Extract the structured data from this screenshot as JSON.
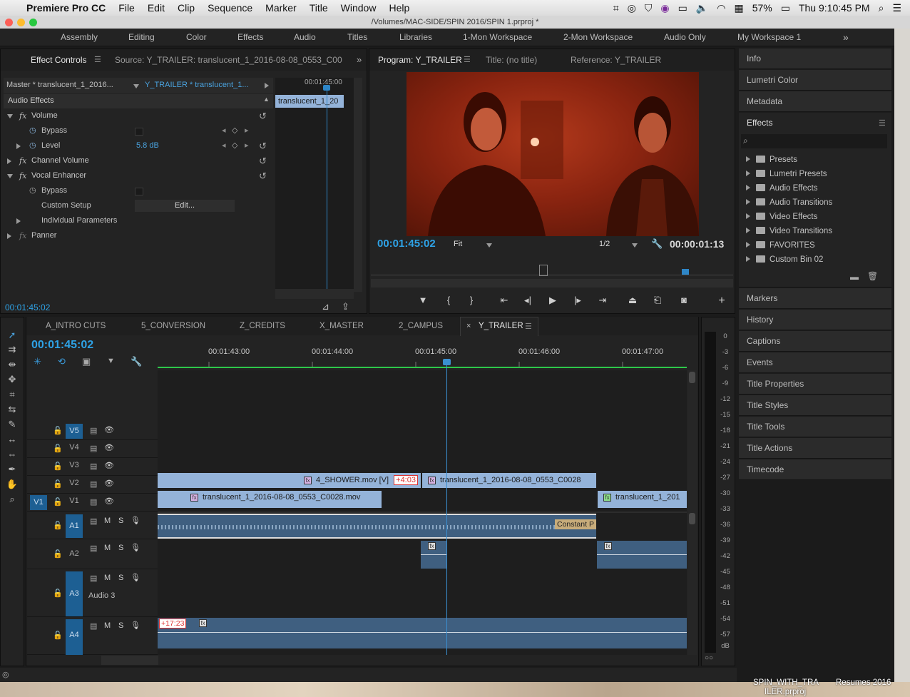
{
  "menubar": {
    "app_name": "Premiere Pro CC",
    "items": [
      "File",
      "Edit",
      "Clip",
      "Sequence",
      "Marker",
      "Title",
      "Window",
      "Help"
    ],
    "battery": "57%",
    "clock": "Thu 9:10:45 PM"
  },
  "window": {
    "title": "/Volumes/MAC-SIDE/SPIN 2016/SPIN 1.prproj *"
  },
  "workspaces": [
    "Assembly",
    "Editing",
    "Color",
    "Effects",
    "Audio",
    "Titles",
    "Libraries",
    "1-Mon Workspace",
    "2-Mon Workspace",
    "Audio Only",
    "My Workspace 1"
  ],
  "effect_controls": {
    "tab_active": "Effect Controls",
    "tab_source": "Source: Y_TRAILER: translucent_1_2016-08-08_0553_C00",
    "master_label": "Master * translucent_1_2016...",
    "sequence_label": "Y_TRAILER * translucent_1...",
    "ruler_time": "00:01:45:00",
    "clip_name": "translucent_1_20",
    "section": "Audio Effects",
    "rows": [
      {
        "name": "Volume",
        "type": "fx"
      },
      {
        "name": "Bypass",
        "type": "param"
      },
      {
        "name": "Level",
        "type": "param",
        "value": "5.8 dB"
      },
      {
        "name": "Channel Volume",
        "type": "fx"
      },
      {
        "name": "Vocal Enhancer",
        "type": "fx"
      },
      {
        "name": "Bypass",
        "type": "param"
      },
      {
        "name": "Custom Setup",
        "type": "param",
        "value": "Edit..."
      },
      {
        "name": "Individual Parameters",
        "type": "param"
      },
      {
        "name": "Panner",
        "type": "fx"
      }
    ],
    "timecode": "00:01:45:02"
  },
  "program": {
    "tab_active": "Program: Y_TRAILER",
    "tab_title": "Title: (no title)",
    "tab_reference": "Reference: Y_TRAILER",
    "timecode": "00:01:45:02",
    "zoom": "Fit",
    "resolution": "1/2",
    "duration": "00:00:01:13"
  },
  "right_panel": {
    "top_items": [
      "Info",
      "Lumetri Color",
      "Metadata"
    ],
    "effects_title": "Effects",
    "effects_items": [
      "Presets",
      "Lumetri Presets",
      "Audio Effects",
      "Audio Transitions",
      "Video Effects",
      "Video Transitions",
      "FAVORITES",
      "Custom Bin 02"
    ],
    "bottom_items": [
      "Markers",
      "History",
      "Captions",
      "Events",
      "Title Properties",
      "Title Styles",
      "Title Tools",
      "Title Actions",
      "Timecode"
    ]
  },
  "timeline": {
    "tabs": [
      "A_INTRO CUTS",
      "5_CONVERSION",
      "Z_CREDITS",
      "X_MASTER",
      "2_CAMPUS",
      "Y_TRAILER"
    ],
    "active_tab": "Y_TRAILER",
    "timecode": "00:01:45:02",
    "ruler": [
      "00:01:43:00",
      "00:01:44:00",
      "00:01:45:00",
      "00:01:46:00",
      "00:01:47:00"
    ],
    "video_tracks": [
      "V5",
      "V4",
      "V3",
      "V2",
      "V1"
    ],
    "audio_tracks": [
      "A1",
      "A2",
      "A3",
      "A4"
    ],
    "source_patch": "V1",
    "audio3_name": "Audio 3",
    "clips": {
      "v2_a": "4_SHOWER.mov [V]",
      "v2_a_badge": "+4:03",
      "v2_b": "translucent_1_2016-08-08_0553_C0028",
      "v1_a": "translucent_1_2016-08-08_0553_C0028.mov",
      "v1_b": "translucent_1_201",
      "a1_transition": "Constant P",
      "a4_badge": "+17:23"
    },
    "track_buttons": {
      "mute": "M",
      "solo": "S"
    }
  },
  "meter": {
    "labels": [
      "0",
      "-3",
      "-6",
      "-9",
      "-12",
      "-15",
      "-18",
      "-21",
      "-24",
      "-27",
      "-30",
      "-33",
      "-36",
      "-39",
      "-42",
      "-45",
      "-48",
      "-51",
      "-54",
      "-57",
      "dB"
    ]
  },
  "desktop": {
    "files": [
      "SPIN_WITH_TRA",
      "ILER.prproj",
      "Resumes 2016"
    ]
  }
}
